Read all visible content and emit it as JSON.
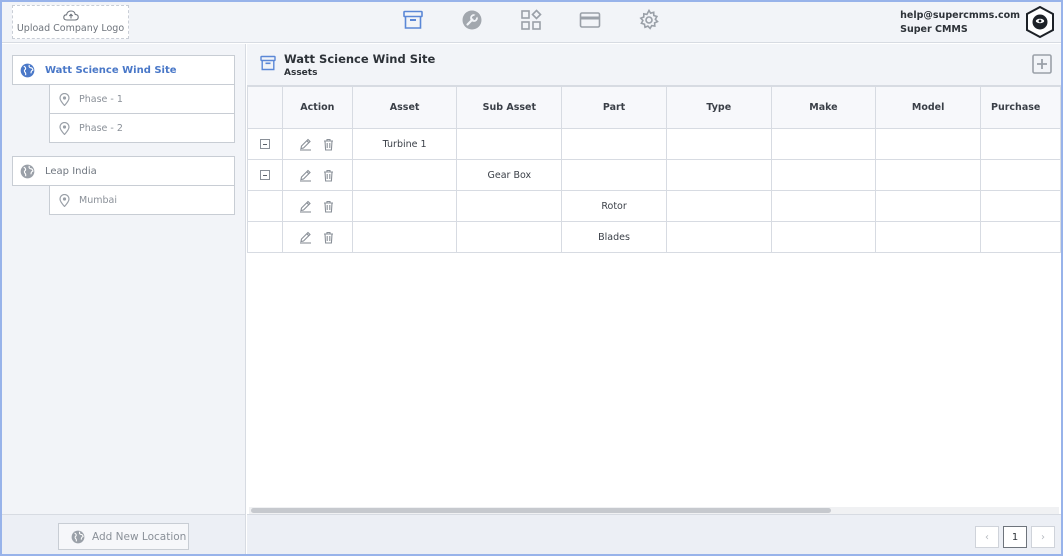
{
  "header": {
    "upload_logo_label": "Upload Company Logo",
    "nav_icons": [
      "archive-icon",
      "wrench-icon",
      "widgets-icon",
      "card-icon",
      "gear-icon"
    ],
    "user_email": "help@supercmms.com",
    "user_name": "Super CMMS"
  },
  "sidebar": {
    "locations": [
      {
        "name": "Watt Science Wind Site",
        "active": true,
        "children": [
          "Phase - 1",
          "Phase - 2"
        ]
      },
      {
        "name": "Leap India",
        "active": false,
        "children": [
          "Mumbai"
        ]
      }
    ],
    "add_location_label": "Add New Location"
  },
  "main": {
    "title": "Watt Science Wind Site",
    "subtitle": "Assets",
    "table": {
      "columns": [
        "Action",
        "Asset",
        "Sub Asset",
        "Part",
        "Type",
        "Make",
        "Model",
        "Purchase"
      ],
      "rows": [
        {
          "expandable": true,
          "asset": "Turbine 1",
          "sub_asset": "",
          "part": ""
        },
        {
          "expandable": true,
          "asset": "",
          "sub_asset": "Gear Box",
          "part": ""
        },
        {
          "expandable": false,
          "asset": "",
          "sub_asset": "",
          "part": "Rotor"
        },
        {
          "expandable": false,
          "asset": "",
          "sub_asset": "",
          "part": "Blades"
        }
      ]
    },
    "pagination": {
      "current_page": "1",
      "prev": "‹",
      "next": "›"
    }
  },
  "colors": {
    "accent": "#4a78c8",
    "frame_border": "#98b3ea",
    "icon_gray": "#9aa0a8"
  }
}
